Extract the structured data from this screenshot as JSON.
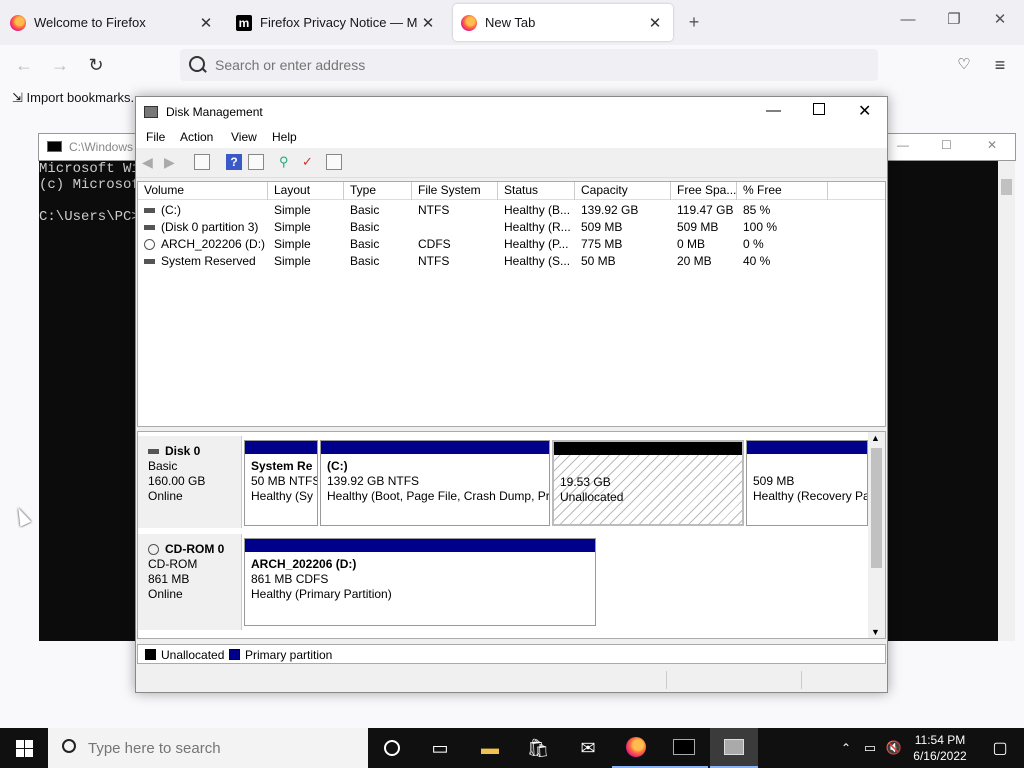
{
  "firefox": {
    "tabs": [
      {
        "title": "Welcome to Firefox",
        "active": false
      },
      {
        "title": "Firefox Privacy Notice — Mozill",
        "active": false
      },
      {
        "title": "New Tab",
        "active": true
      }
    ],
    "url_placeholder": "Search or enter address",
    "bookmarks": [
      "Import bookmarks..."
    ]
  },
  "console": {
    "title": "C:\\Windows",
    "lines": "Microsoft Wi\n(c) Microsof\n\nC:\\Users\\PC>"
  },
  "disk_management": {
    "title": "Disk Management",
    "menu": [
      "File",
      "Action",
      "View",
      "Help"
    ],
    "columns": [
      "Volume",
      "Layout",
      "Type",
      "File System",
      "Status",
      "Capacity",
      "Free Spa...",
      "% Free"
    ],
    "volumes": [
      {
        "volume": "(C:)",
        "layout": "Simple",
        "type": "Basic",
        "fs": "NTFS",
        "status": "Healthy (B...",
        "capacity": "139.92 GB",
        "free": "119.47 GB",
        "pct": "85 %"
      },
      {
        "volume": "(Disk 0 partition 3)",
        "layout": "Simple",
        "type": "Basic",
        "fs": "",
        "status": "Healthy (R...",
        "capacity": "509 MB",
        "free": "509 MB",
        "pct": "100 %"
      },
      {
        "volume": "ARCH_202206 (D:)",
        "layout": "Simple",
        "type": "Basic",
        "fs": "CDFS",
        "status": "Healthy (P...",
        "capacity": "775 MB",
        "free": "0 MB",
        "pct": "0 %"
      },
      {
        "volume": "System Reserved",
        "layout": "Simple",
        "type": "Basic",
        "fs": "NTFS",
        "status": "Healthy (S...",
        "capacity": "50 MB",
        "free": "20 MB",
        "pct": "40 %"
      }
    ],
    "disks": [
      {
        "name": "Disk 0",
        "type": "Basic",
        "size": "160.00 GB",
        "state": "Online",
        "partitions": [
          {
            "name": "System Re",
            "line2": "50 MB NTFS",
            "line3": "Healthy (Sy"
          },
          {
            "name": "(C:)",
            "line2": "139.92 GB NTFS",
            "line3": "Healthy (Boot, Page File, Crash Dump, Pr"
          },
          {
            "name": "",
            "line2": "19.53 GB",
            "line3": "Unallocated"
          },
          {
            "name": "",
            "line2": "509 MB",
            "line3": "Healthy (Recovery Pa"
          }
        ]
      },
      {
        "name": "CD-ROM 0",
        "type": "CD-ROM",
        "size": "861 MB",
        "state": "Online",
        "partitions": [
          {
            "name": "ARCH_202206  (D:)",
            "line2": "861 MB CDFS",
            "line3": "Healthy (Primary Partition)"
          }
        ]
      }
    ],
    "legend": [
      "Unallocated",
      "Primary partition"
    ]
  },
  "taskbar": {
    "search_placeholder": "Type here to search",
    "time": "11:54 PM",
    "date": "6/16/2022"
  }
}
